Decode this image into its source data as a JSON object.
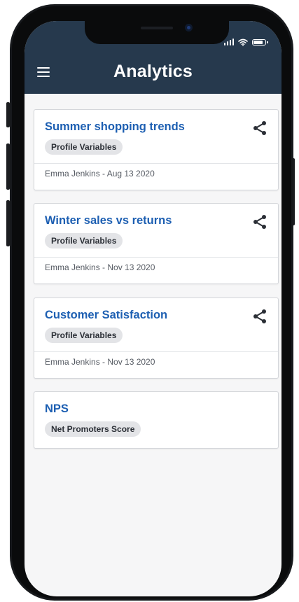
{
  "app": {
    "title": "Analytics"
  },
  "cards": [
    {
      "title": "Summer shopping trends",
      "tag": "Profile Variables",
      "meta": "Emma Jenkins - Aug 13 2020",
      "share": true
    },
    {
      "title": "Winter sales vs returns",
      "tag": "Profile Variables",
      "meta": "Emma Jenkins - Nov 13 2020",
      "share": true
    },
    {
      "title": "Customer Satisfaction",
      "tag": "Profile Variables",
      "meta": "Emma Jenkins - Nov 13 2020",
      "share": true
    },
    {
      "title": "NPS",
      "tag": "Net Promoters Score",
      "share": false
    }
  ],
  "icons": {
    "menu": "hamburger-menu-icon",
    "share": "share-icon",
    "signal": "cellular-signal-icon",
    "wifi": "wifi-icon",
    "battery": "battery-icon"
  },
  "colors": {
    "app_bar": "#26394d",
    "card_title": "#1d5fb2",
    "tag_bg": "#e3e4e7",
    "background": "#f6f6f7"
  }
}
